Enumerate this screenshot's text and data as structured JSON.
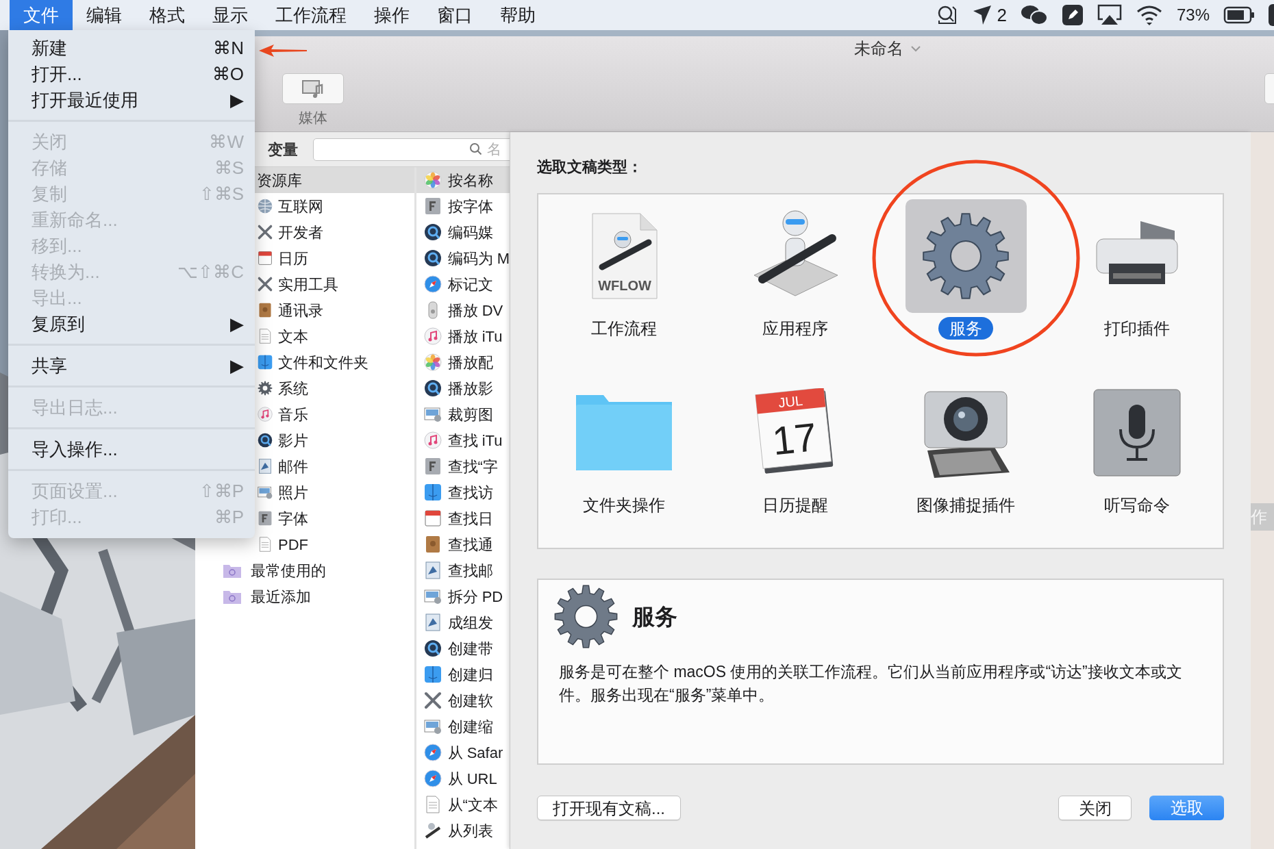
{
  "menu_bar": {
    "menus": [
      {
        "label": "文件",
        "selected": true
      },
      {
        "label": "编辑",
        "selected": false
      },
      {
        "label": "格式",
        "selected": false
      },
      {
        "label": "显示",
        "selected": false
      },
      {
        "label": "工作流程",
        "selected": false
      },
      {
        "label": "操作",
        "selected": false
      },
      {
        "label": "窗口",
        "selected": false
      },
      {
        "label": "帮助",
        "selected": false
      }
    ],
    "status": {
      "notification_count": "2",
      "battery": "73%"
    }
  },
  "file_menu": {
    "groups": [
      [
        {
          "label": "新建",
          "shortcut": "⌘N",
          "disabled": false
        },
        {
          "label": "打开...",
          "shortcut": "⌘O",
          "disabled": false
        },
        {
          "label": "打开最近使用",
          "shortcut": "▶",
          "disabled": false
        }
      ],
      [
        {
          "label": "关闭",
          "shortcut": "⌘W",
          "disabled": true
        },
        {
          "label": "存储",
          "shortcut": "⌘S",
          "disabled": true
        },
        {
          "label": "复制",
          "shortcut": "⇧⌘S",
          "disabled": true
        },
        {
          "label": "重新命名...",
          "disabled": true
        },
        {
          "label": "移到...",
          "disabled": true
        },
        {
          "label": "转换为...",
          "shortcut": "⌥⇧⌘C",
          "disabled": true
        },
        {
          "label": "导出...",
          "disabled": true
        },
        {
          "label": "复原到",
          "shortcut": "▶",
          "disabled": false
        }
      ],
      [
        {
          "label": "共享",
          "shortcut": "▶",
          "disabled": false
        }
      ],
      [
        {
          "label": "导出日志...",
          "disabled": true
        }
      ],
      [
        {
          "label": "导入操作...",
          "disabled": false
        }
      ],
      [
        {
          "label": "页面设置...",
          "shortcut": "⇧⌘P",
          "disabled": true
        },
        {
          "label": "打印...",
          "shortcut": "⌘P",
          "disabled": true
        }
      ]
    ]
  },
  "window": {
    "title": "未命名",
    "toolbar": [
      {
        "label": "媒体"
      }
    ],
    "search": {
      "label": "变量",
      "placeholder": "名"
    },
    "library": [
      {
        "label": "资源库",
        "selected": true,
        "children": [
          {
            "label": "互联网",
            "kind": "globe",
            "selected": false
          },
          {
            "label": "开发者",
            "kind": "tools",
            "selected": false
          },
          {
            "label": "日历",
            "kind": "calendar",
            "selected": false
          },
          {
            "label": "实用工具",
            "kind": "tools",
            "selected": false
          },
          {
            "label": "通讯录",
            "kind": "contacts",
            "selected": false
          },
          {
            "label": "文本",
            "kind": "text",
            "selected": false
          },
          {
            "label": "文件和文件夹",
            "kind": "finder",
            "selected": false
          },
          {
            "label": "系统",
            "kind": "gear",
            "selected": false
          },
          {
            "label": "音乐",
            "kind": "music",
            "selected": false
          },
          {
            "label": "影片",
            "kind": "quicktime",
            "selected": false
          },
          {
            "label": "邮件",
            "kind": "mail",
            "selected": false
          },
          {
            "label": "照片",
            "kind": "preview",
            "selected": false
          },
          {
            "label": "字体",
            "kind": "font",
            "selected": false
          },
          {
            "label": "PDF",
            "kind": "text",
            "selected": false
          }
        ]
      },
      {
        "label": "最常使用的",
        "kind": "smart-folder",
        "selected": false
      },
      {
        "label": "最近添加",
        "kind": "smart-folder",
        "selected": false
      }
    ],
    "actions": [
      {
        "label": "按名称",
        "kind": "photos",
        "selected": true
      },
      {
        "label": "按字体",
        "kind": "font",
        "selected": false
      },
      {
        "label": "编码媒",
        "kind": "quicktime",
        "selected": false
      },
      {
        "label": "编码为 M",
        "kind": "quicktime",
        "selected": false
      },
      {
        "label": "标记文",
        "kind": "safari",
        "selected": false
      },
      {
        "label": "播放 DV",
        "kind": "dvd",
        "selected": false
      },
      {
        "label": "播放 iTu",
        "kind": "music",
        "selected": false
      },
      {
        "label": "播放配",
        "kind": "photos",
        "selected": false
      },
      {
        "label": "播放影",
        "kind": "quicktime",
        "selected": false
      },
      {
        "label": "裁剪图",
        "kind": "preview",
        "selected": false
      },
      {
        "label": "查找 iTu",
        "kind": "music",
        "selected": false
      },
      {
        "label": "查找“字",
        "kind": "font",
        "selected": false
      },
      {
        "label": "查找访",
        "kind": "finder",
        "selected": false
      },
      {
        "label": "查找日",
        "kind": "calendar",
        "selected": false
      },
      {
        "label": "查找通",
        "kind": "contacts",
        "selected": false
      },
      {
        "label": "查找邮",
        "kind": "mail",
        "selected": false
      },
      {
        "label": "拆分 PD",
        "kind": "preview",
        "selected": false
      },
      {
        "label": "成组发",
        "kind": "mail",
        "selected": false
      },
      {
        "label": "创建带",
        "kind": "quicktime",
        "selected": false
      },
      {
        "label": "创建归",
        "kind": "finder",
        "selected": false
      },
      {
        "label": "创建软",
        "kind": "tools",
        "selected": false
      },
      {
        "label": "创建缩",
        "kind": "preview",
        "selected": false
      },
      {
        "label": "从 Safar",
        "kind": "safari",
        "selected": false
      },
      {
        "label": "从 URL",
        "kind": "safari",
        "selected": false
      },
      {
        "label": "从“文本",
        "kind": "text",
        "selected": false
      },
      {
        "label": "从列表",
        "kind": "automator",
        "selected": false
      }
    ],
    "background_tab": "作"
  },
  "sheet": {
    "prompt": "选取文稿类型：",
    "types": [
      {
        "kind": "workflow",
        "label": "工作流程",
        "selected": false,
        "icon_text": "WFLOW"
      },
      {
        "kind": "application",
        "label": "应用程序",
        "selected": false
      },
      {
        "kind": "service",
        "label": "服务",
        "selected": true
      },
      {
        "kind": "print",
        "label": "打印插件",
        "selected": false
      },
      {
        "kind": "folder",
        "label": "文件夹操作",
        "selected": false
      },
      {
        "kind": "calendar",
        "label": "日历提醒",
        "selected": false,
        "icon_month": "JUL",
        "icon_day": "17"
      },
      {
        "kind": "camera",
        "label": "图像捕捉插件",
        "selected": false
      },
      {
        "kind": "dictation",
        "label": "听写命令",
        "selected": false
      }
    ],
    "description": {
      "title": "服务",
      "text": "服务是可在整个 macOS 使用的关联工作流程。它们从当前应用程序或“访达”接收文本或文件。服务出现在“服务”菜单中。"
    },
    "buttons": [
      {
        "label": "打开现有文稿...",
        "kind": "normal"
      },
      {
        "label": "关闭",
        "kind": "normal"
      },
      {
        "label": "选取",
        "kind": "default"
      }
    ]
  }
}
